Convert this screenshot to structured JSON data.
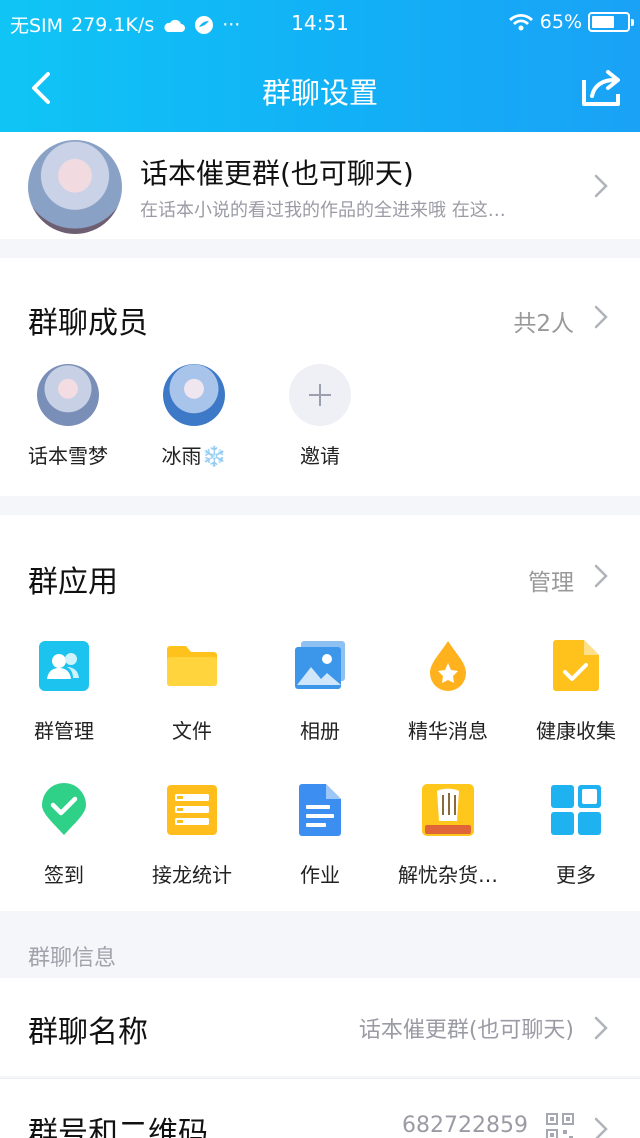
{
  "status_bar": {
    "carrier": "无SIM",
    "speed": "279.1K/s",
    "more": "···",
    "time": "14:51",
    "battery_text": "65%",
    "battery_level": 0.65
  },
  "nav": {
    "title": "群聊设置"
  },
  "group": {
    "name": "话本催更群(也可聊天)",
    "description": "在话本小说的看过我的作品的全进来哦 在这…"
  },
  "members": {
    "title": "群聊成员",
    "count": "共2人",
    "items": [
      {
        "name": "话本雪梦"
      },
      {
        "name": "冰雨❄️"
      },
      {
        "name": "邀请"
      }
    ]
  },
  "apps": {
    "title": "群应用",
    "manage": "管理",
    "items": [
      {
        "label": "群管理",
        "icon": "group-manage-icon"
      },
      {
        "label": "文件",
        "icon": "folder-icon"
      },
      {
        "label": "相册",
        "icon": "album-icon"
      },
      {
        "label": "精华消息",
        "icon": "drop-star-icon"
      },
      {
        "label": "健康收集",
        "icon": "health-check-icon"
      },
      {
        "label": "签到",
        "icon": "check-in-icon"
      },
      {
        "label": "接龙统计",
        "icon": "relay-stats-icon"
      },
      {
        "label": "作业",
        "icon": "homework-icon"
      },
      {
        "label": "解忧杂货…",
        "icon": "grocery-store-icon"
      },
      {
        "label": "更多",
        "icon": "more-grid-icon"
      }
    ]
  },
  "info": {
    "section_label": "群聊信息",
    "rows": [
      {
        "key": "群聊名称",
        "value": "话本催更群(也可聊天)"
      },
      {
        "key": "群号和二维码",
        "value": "682722859"
      }
    ]
  },
  "colors": {
    "header_start": "#10c5f5",
    "header_end": "#1aa2f6",
    "background": "#f5f6fa"
  }
}
